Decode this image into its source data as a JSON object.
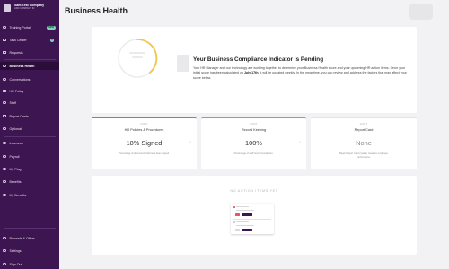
{
  "company": {
    "name": "Sam Test Company",
    "subtitle": "ADD COMPANY ID"
  },
  "sidebar": {
    "items": [
      {
        "label": "Training Portal",
        "icon": "graduation-icon",
        "badge": "NEW"
      },
      {
        "label": "Task Center",
        "icon": "checklist-icon",
        "count": "2"
      },
      {
        "label": "Requests",
        "icon": "inbox-icon"
      },
      {
        "label": "Business Health",
        "icon": "heart-pulse-icon",
        "active": true
      },
      {
        "label": "Conversations",
        "icon": "chat-icon"
      },
      {
        "label": "HR Policy",
        "icon": "document-icon"
      },
      {
        "label": "Staff",
        "icon": "people-icon"
      },
      {
        "label": "Report Cards",
        "icon": "report-icon"
      },
      {
        "label": "Optional",
        "icon": "plus-icon"
      },
      {
        "label": "Insurance",
        "icon": "shield-icon"
      },
      {
        "label": "Payroll",
        "icon": "dollar-icon"
      },
      {
        "label": "My Plug",
        "icon": "plug-icon"
      },
      {
        "label": "Benefits",
        "icon": "gift-icon"
      },
      {
        "label": "My Benefits",
        "icon": "star-icon"
      },
      {
        "label": "Rewards & Offers",
        "icon": "tag-icon"
      },
      {
        "label": "Settings",
        "icon": "gear-icon"
      },
      {
        "label": "Sign Out",
        "icon": "logout-icon"
      }
    ]
  },
  "header": {
    "title": "Business Health"
  },
  "compliance": {
    "title": "Your Business Compliance Indicator is Pending",
    "body_1": "Your HR Manager and our technology are working together to determine your Business Health score and your upcoming HR action items. Once your initial score has been calculated on ",
    "body_date": "July 17th",
    "body_2": ", it will be updated weekly. In the meantime, you can review and address the factors that may affect your score below."
  },
  "metrics": [
    {
      "sup": "AUDIT",
      "label": "HR Policies & Procedures",
      "value": "18% Signed",
      "desc": "Percentage of documents that have been signed.",
      "accent": "#e05a5a"
    },
    {
      "sup": "AUDIT",
      "label": "Record Keeping",
      "value": "100%",
      "desc": "Percentage of staff record completion.",
      "accent": "#47c2a0"
    },
    {
      "sup": "AUDIT",
      "label": "Report Card",
      "value": "None",
      "desc": "Begin Report Card cycle to measure employee performance.",
      "accent": "#e4e4e6"
    }
  ],
  "actions": {
    "title": "NO ACTION ITEMS YET"
  },
  "colors": {
    "sidebar": "#3d1550",
    "sidebar_active": "#2a0d38",
    "accent_teal": "#47c2a0",
    "accent_red": "#e05a5a",
    "gauge": "#f0c94a"
  }
}
